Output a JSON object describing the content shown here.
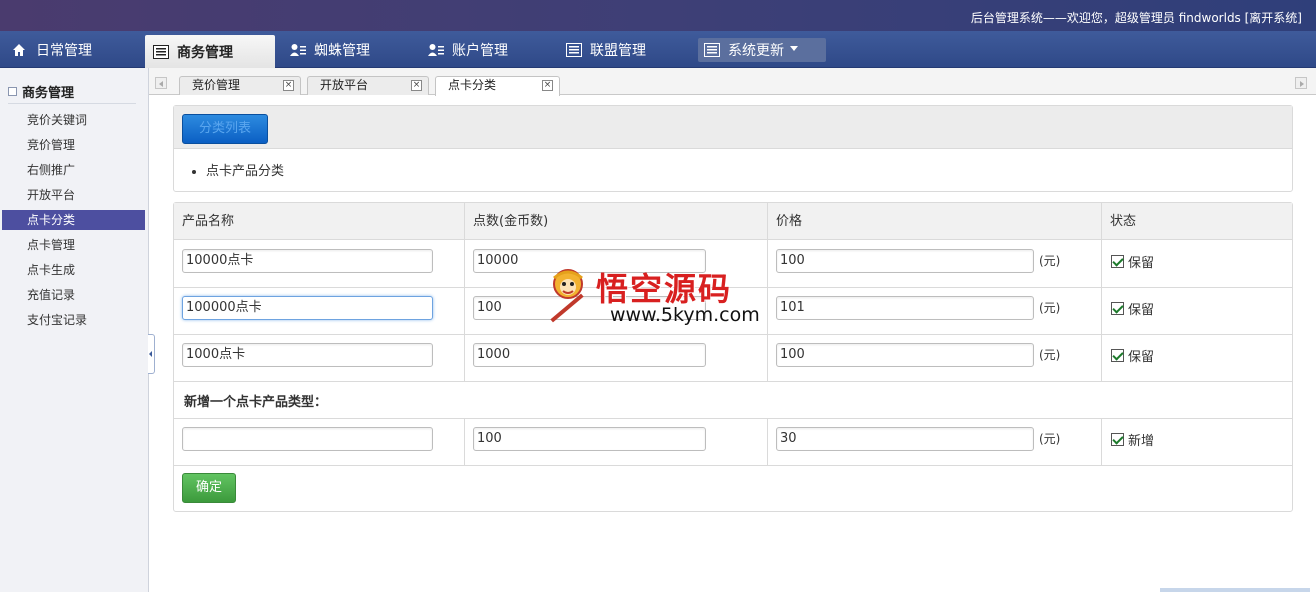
{
  "header": {
    "welcome": "后台管理系统——欢迎您，超级管理员 findworlds [离开系统]"
  },
  "nav": {
    "items": [
      {
        "label": "日常管理",
        "icon": "home-icon"
      },
      {
        "label": "商务管理",
        "icon": "list-icon",
        "active": true
      },
      {
        "label": "蜘蛛管理",
        "icon": "user-list-icon"
      },
      {
        "label": "账户管理",
        "icon": "user-list-icon"
      },
      {
        "label": "联盟管理",
        "icon": "list-icon"
      },
      {
        "label": "系统更新",
        "icon": "list-icon",
        "dropdown": true
      }
    ]
  },
  "sidebar": {
    "title": "商务管理",
    "items": [
      {
        "label": "竞价关键词"
      },
      {
        "label": "竞价管理"
      },
      {
        "label": "右侧推广"
      },
      {
        "label": "开放平台"
      },
      {
        "label": "点卡分类",
        "active": true
      },
      {
        "label": "点卡管理"
      },
      {
        "label": "点卡生成"
      },
      {
        "label": "充值记录"
      },
      {
        "label": "支付宝记录"
      }
    ]
  },
  "tabs": [
    {
      "label": "竞价管理"
    },
    {
      "label": "开放平台"
    },
    {
      "label": "点卡分类",
      "active": true
    }
  ],
  "panel": {
    "button_label": "分类列表",
    "bullet": "点卡产品分类"
  },
  "table": {
    "columns": [
      "产品名称",
      "点数(金币数)",
      "价格",
      "状态"
    ],
    "rows": [
      {
        "name": "10000点卡",
        "points": "10000",
        "price": "100",
        "unit": "(元)",
        "status": "保留"
      },
      {
        "name": "100000点卡",
        "points": "100",
        "price": "101",
        "unit": "(元)",
        "status": "保留"
      },
      {
        "name": "1000点卡",
        "points": "1000",
        "price": "100",
        "unit": "(元)",
        "status": "保留"
      }
    ],
    "add_title": "新增一个点卡产品类型：",
    "new_row": {
      "name": "",
      "points": "100",
      "price": "30",
      "unit": "(元)",
      "status": "新增"
    },
    "submit_label": "确定"
  },
  "watermark": {
    "title": "悟空源码",
    "url": "www.5kym.com"
  },
  "colors": {
    "primary_button": "#1a74d4",
    "ok_button": "#4cae4c",
    "sidebar_active": "#4d4fa0",
    "nav_bg": "#34508f"
  }
}
